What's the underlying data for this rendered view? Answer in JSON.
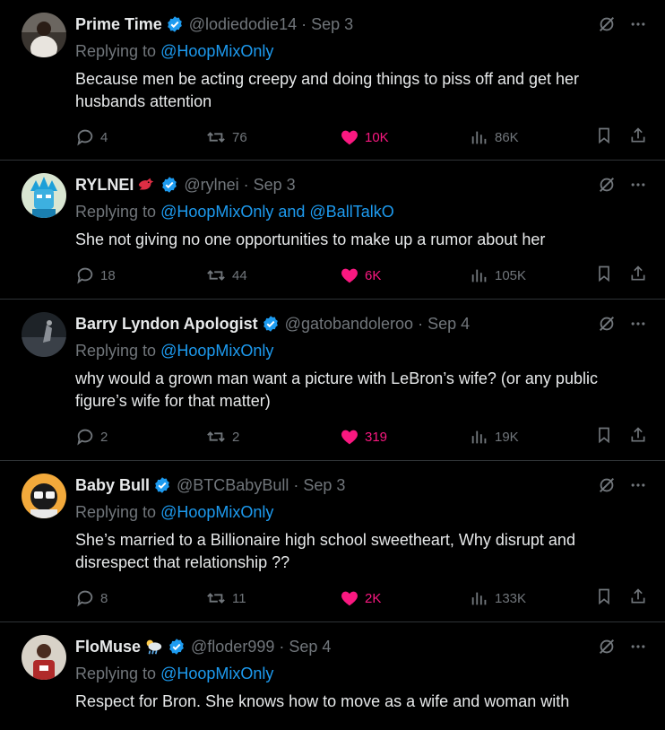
{
  "colors": {
    "accent": "#1d9bf0",
    "like": "#f91880",
    "muted": "#71767b",
    "text": "#e7e9ea"
  },
  "tweets": [
    {
      "name": "Prime Time",
      "handle": "@lodiedodie14",
      "date": "Sep 3",
      "reply_prefix": "Replying to ",
      "reply_to": "@HoopMixOnly",
      "text": "Because men be acting creepy and doing things to piss off and get her husbands attention",
      "replies": "4",
      "retweets": "76",
      "likes": "10K",
      "views": "86K"
    },
    {
      "name": "RYLNEI",
      "emoji": "red-bird-icon",
      "handle": "@rylnei",
      "date": "Sep 3",
      "reply_prefix": "Replying to ",
      "reply_to": "@HoopMixOnly and @BallTalkO",
      "text": "She not giving no one opportunities to make up a rumor about her",
      "replies": "18",
      "retweets": "44",
      "likes": "6K",
      "views": "105K"
    },
    {
      "name": "Barry Lyndon Apologist",
      "handle": "@gatobandoleroo",
      "date": "Sep 4",
      "reply_prefix": "Replying to ",
      "reply_to": "@HoopMixOnly",
      "text": "why would a grown man want a picture with LeBron’s wife? (or any public figure’s wife for that matter)",
      "replies": "2",
      "retweets": "2",
      "likes": "319",
      "views": "19K"
    },
    {
      "name": "Baby Bull",
      "handle": "@BTCBabyBull",
      "date": "Sep 3",
      "reply_prefix": "Replying to ",
      "reply_to": "@HoopMixOnly",
      "text": "She’s married to a Billionaire high school sweetheart, Why disrupt and disrespect that relationship ??",
      "replies": "8",
      "retweets": "11",
      "likes": "2K",
      "views": "133K"
    },
    {
      "name": "FloMuse",
      "emoji": "rain-cloud-icon",
      "handle": "@floder999",
      "date": "Sep 4",
      "reply_prefix": "Replying to ",
      "reply_to": "@HoopMixOnly",
      "text": "Respect for Bron. She knows how to move as a wife and woman with"
    }
  ]
}
